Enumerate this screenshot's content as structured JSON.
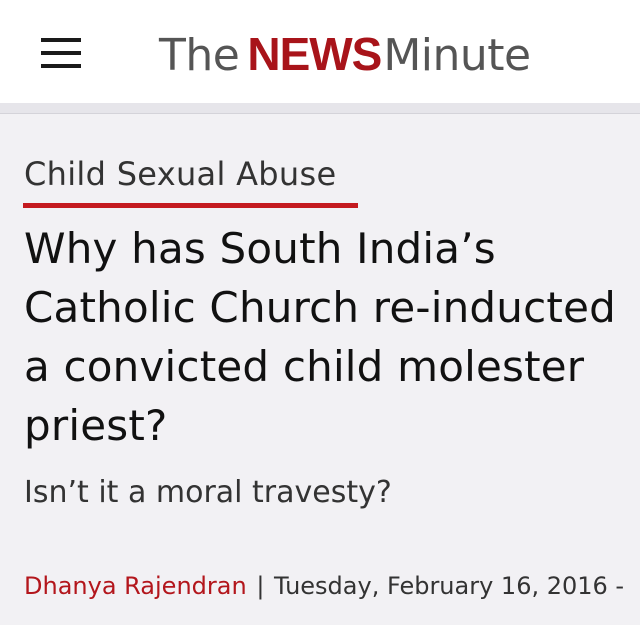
{
  "header": {
    "menu_icon": "hamburger-menu-icon",
    "logo": {
      "the": "The",
      "news": "NEWS",
      "minute": "Minute"
    },
    "colors": {
      "brand_red": "#a8141a",
      "logo_gray": "#555555"
    }
  },
  "article": {
    "category": "Child Sexual Abuse",
    "headline": "Why has South India’s Catholic Church re-inducted a convicted child molester priest?",
    "subtitle": "Isn’t it a moral travesty?",
    "author": "Dhanya Rajendran",
    "separator": "|",
    "date": "Tuesday, February 16, 2016 -"
  }
}
